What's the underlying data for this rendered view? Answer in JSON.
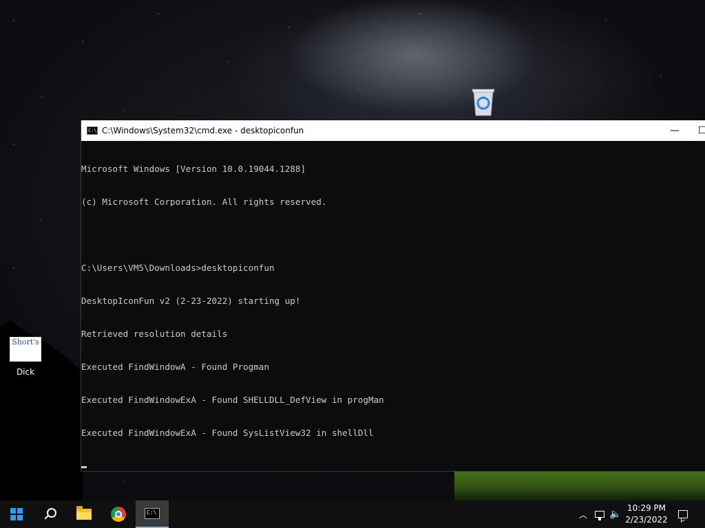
{
  "desktop": {
    "icons": [
      {
        "name": "recycle-bin",
        "label": ""
      },
      {
        "name": "dick",
        "label": "Dick",
        "thumb_text": "Short's"
      }
    ]
  },
  "cmd_window": {
    "title": "C:\\Windows\\System32\\cmd.exe - desktopiconfun",
    "minimize_glyph": "—",
    "maximize_glyph": "☐",
    "icon_text": "C:\\",
    "lines": [
      "Microsoft Windows [Version 10.0.19044.1288]",
      "(c) Microsoft Corporation. All rights reserved.",
      "",
      "C:\\Users\\VM5\\Downloads>desktopiconfun",
      "DesktopIconFun v2 (2-23-2022) starting up!",
      "Retrieved resolution details",
      "Executed FindWindowA - Found Progman",
      "Executed FindWindowExA - Found SHELLDLL_DefView in progMan",
      "Executed FindWindowExA - Found SysListView32 in shellDll"
    ]
  },
  "taskbar": {
    "cmd_icon_text": "C:\\",
    "tray": {
      "chevron": "︿",
      "volume_glyph": "🔈"
    },
    "clock": {
      "time": "10:29 PM",
      "date": "2/23/2022"
    }
  },
  "colors": {
    "console_bg": "#0c0c0c",
    "console_fg": "#cccccc",
    "taskbar_bg": "#101010",
    "accent": "#2a9df4"
  }
}
